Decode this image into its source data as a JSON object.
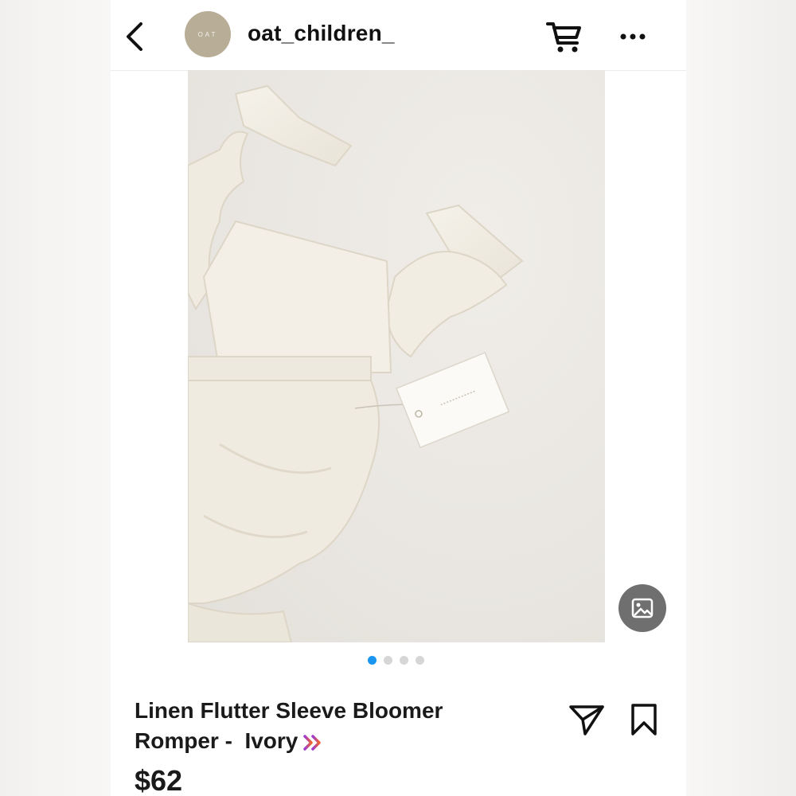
{
  "header": {
    "avatar_text": "OAT",
    "username": "oat_children_",
    "icons": [
      "back-arrow-icon",
      "cart-icon",
      "more-icon"
    ]
  },
  "carousel": {
    "total_images": 4,
    "current_index": 1
  },
  "product": {
    "title_line1": "Linen Flutter Sleeve Bloomer",
    "title_line2": "Romper -  Ivory",
    "price": "$62"
  },
  "actions": {
    "icons": [
      "share-icon",
      "bookmark-icon",
      "image-icon"
    ]
  },
  "colors": {
    "active_dot": "#1a95f0",
    "inactive_dot": "#d6d6d6",
    "avatar_bg": "#b8ad96",
    "chevron_gradient": [
      "#9b3bd6",
      "#f0642c"
    ]
  }
}
